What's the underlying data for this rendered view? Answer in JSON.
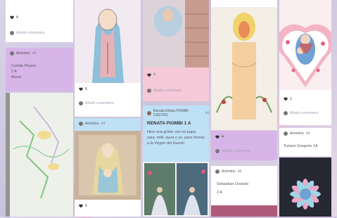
{
  "col1": {
    "like_count": "4",
    "comment_placeholder": "Añadir comentario",
    "post2": {
      "author": "Anónimo",
      "age": "4d",
      "line1": "Camila Pisano",
      "line2": "2 A",
      "line3": "Mural"
    }
  },
  "col2": {
    "like_count": "6",
    "comment_placeholder": "Añadir comentario",
    "author": "Anónimo",
    "age": "4d",
    "like_count_bottom": "5"
  },
  "col3": {
    "like_count": "7",
    "comment_placeholder": "Añadir comentario",
    "post": {
      "author": "Renata Eloisa PIOMBI CASTRO",
      "age": "4d",
      "title": "RENATA PIOMBI 1 A",
      "body": "Hice una grotto con mi papá, sara, milli, laura y yo, para honrar a la Virgen del Huerto"
    }
  },
  "col4": {
    "like_count": "4",
    "comment_placeholder": "Añadir comentario",
    "post": {
      "author": "Anónimo",
      "age": "4d",
      "title": "Sebastian Ovando",
      "sub": "2 A"
    }
  },
  "col5": {
    "like_count": "1",
    "comment_placeholder": "Añadir comentario",
    "post": {
      "author": "Anónimo",
      "age": "4d",
      "title": "Tiziano Gregorio 1A"
    }
  },
  "colors": {
    "pink": "#f6c9d8",
    "lilac": "#d8b5e9",
    "blue": "#bfe1f6"
  }
}
